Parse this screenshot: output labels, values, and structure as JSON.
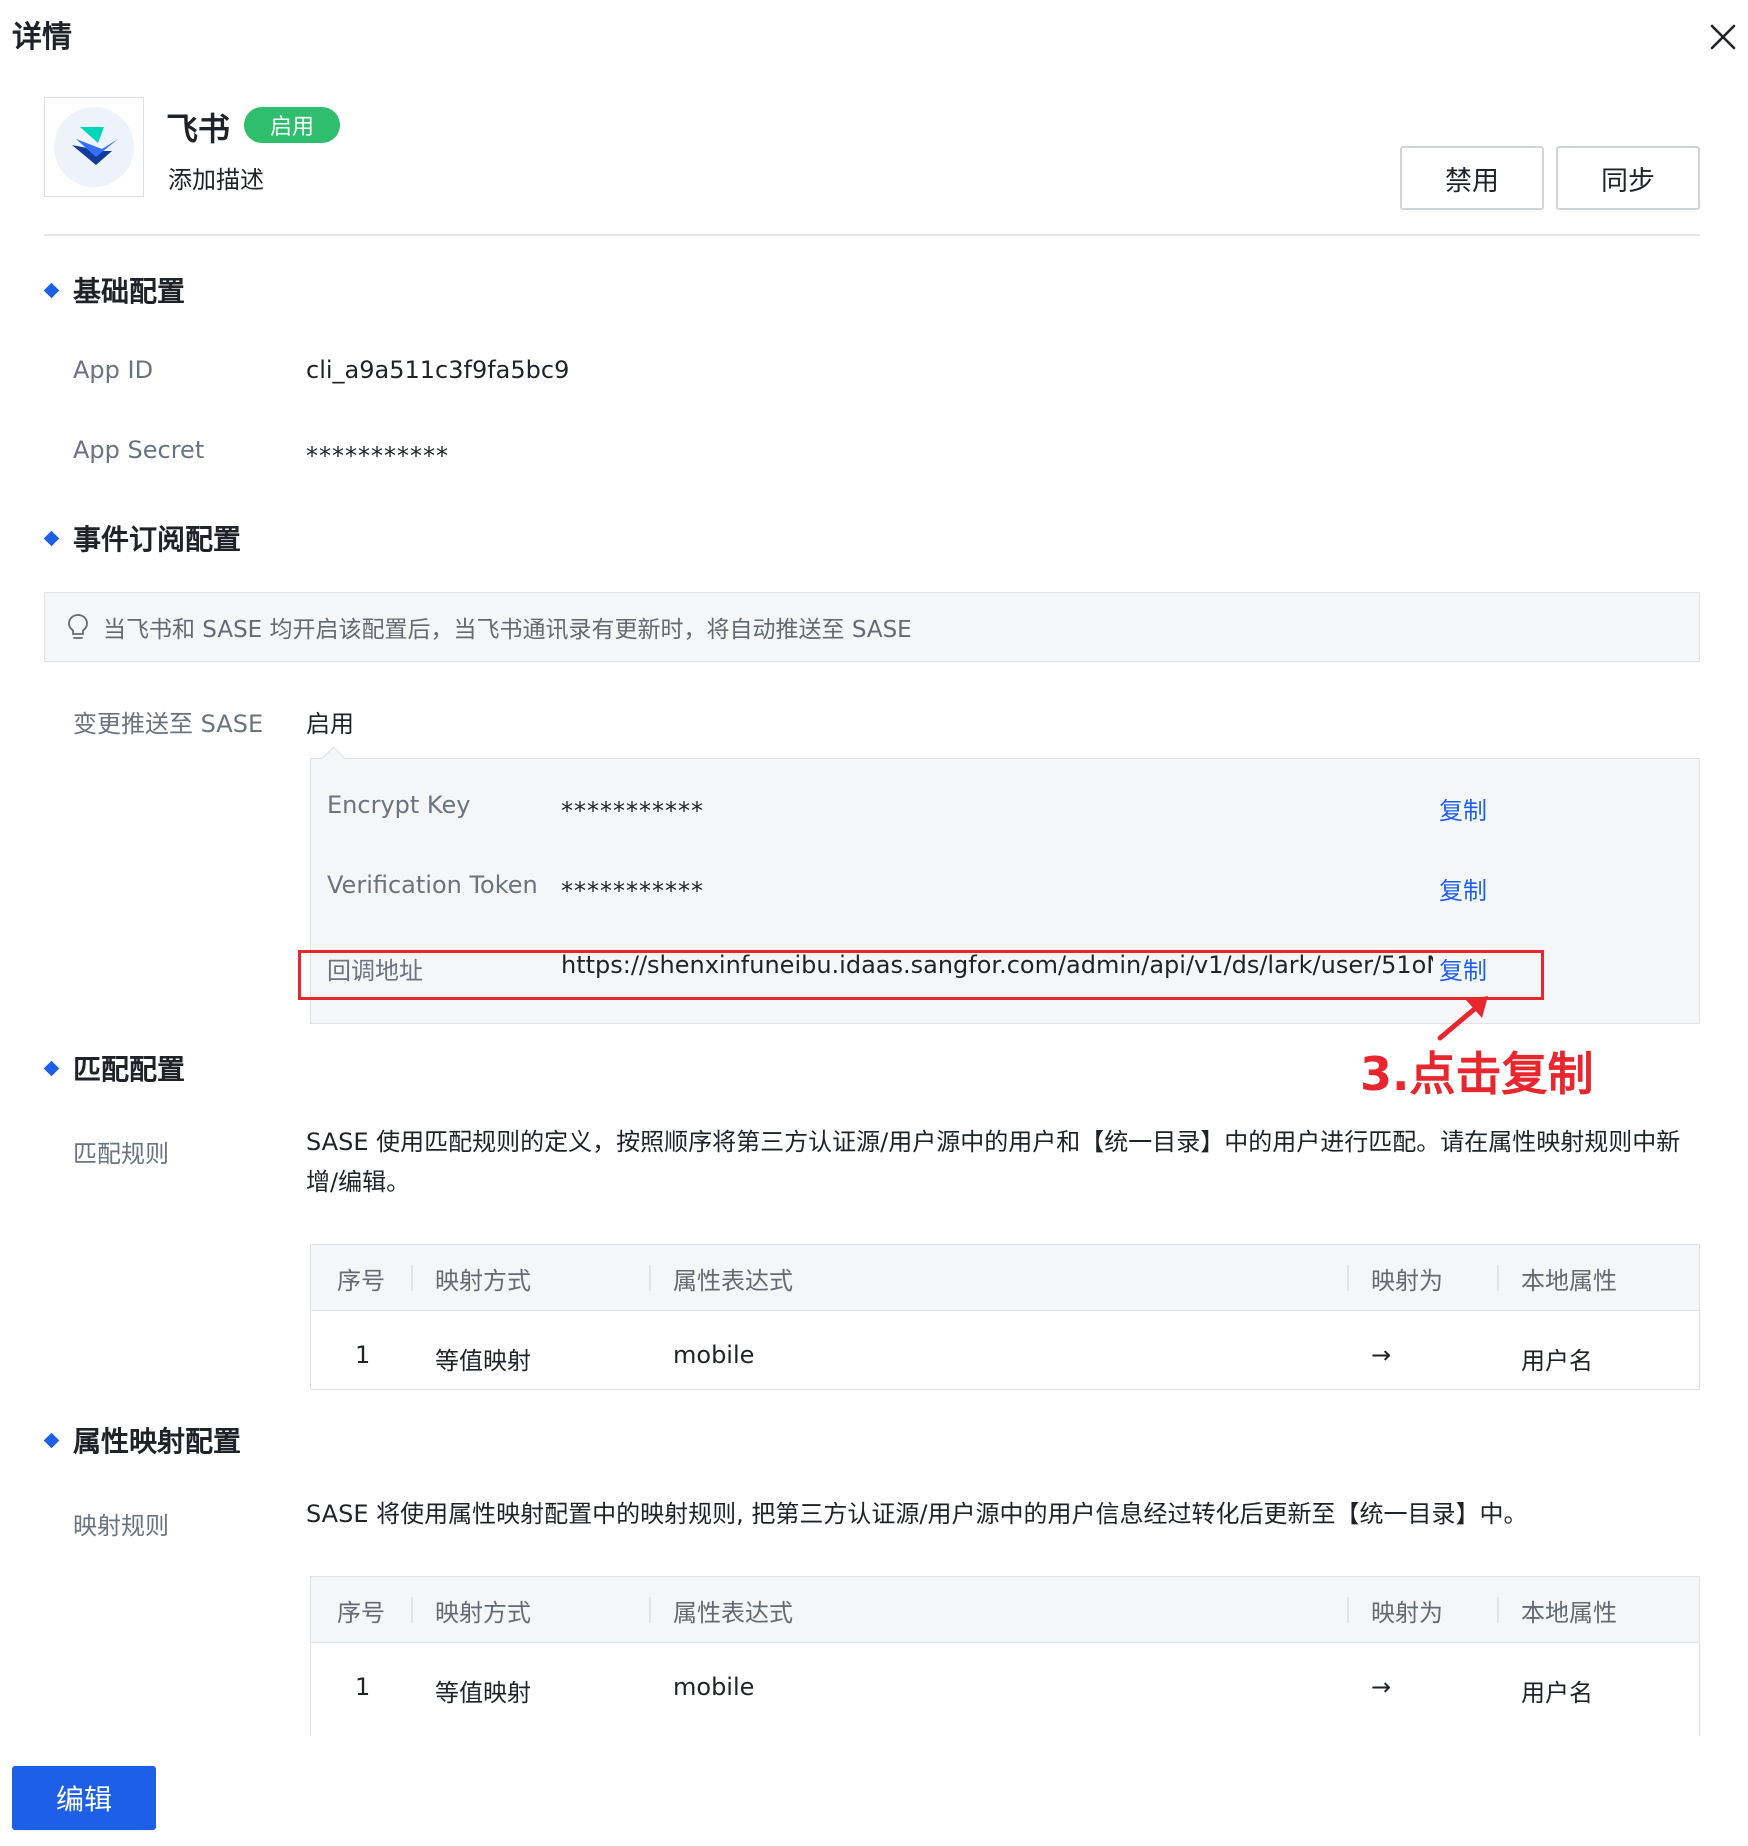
{
  "panel": {
    "title": "详情"
  },
  "app": {
    "name": "飞书",
    "status": "启用",
    "description": "添加描述",
    "disable_label": "禁用",
    "sync_label": "同步"
  },
  "basic": {
    "title": "基础配置",
    "app_id_label": "App ID",
    "app_id_value": "cli_a9a511c3f9fa5bc9",
    "app_secret_label": "App Secret",
    "app_secret_value": "***********"
  },
  "event": {
    "title": "事件订阅配置",
    "tip": "当飞书和 SASE 均开启该配置后，当飞书通讯录有更新时，将自动推送至 SASE",
    "push_label": "变更推送至 SASE",
    "push_value": "启用",
    "rows": [
      {
        "label": "Encrypt Key",
        "value": "***********",
        "action": "复制"
      },
      {
        "label": "Verification Token",
        "value": "***********",
        "action": "复制"
      },
      {
        "label": "回调地址",
        "value": "https://shenxinfuneibu.idaas.sangfor.com/admin/api/v1/ds/lark/user/51oN…",
        "action": "复制"
      }
    ],
    "annotation": "3.点击复制"
  },
  "match": {
    "title": "匹配配置",
    "rule_label": "匹配规则",
    "description": "SASE 使用匹配规则的定义，按照顺序将第三方认证源/用户源中的用户和【统一目录】中的用户进行匹配。请在属性映射规则中新增/编辑。",
    "table": {
      "headers": [
        "序号",
        "映射方式",
        "属性表达式",
        "映射为",
        "本地属性"
      ],
      "rows": [
        [
          "1",
          "等值映射",
          "mobile",
          "→",
          "用户名"
        ]
      ]
    }
  },
  "mapping": {
    "title": "属性映射配置",
    "rule_label": "映射规则",
    "description": "SASE 将使用属性映射配置中的映射规则, 把第三方认证源/用户源中的用户信息经过转化后更新至【统一目录】中。",
    "table": {
      "headers": [
        "序号",
        "映射方式",
        "属性表达式",
        "映射为",
        "本地属性"
      ],
      "rows": [
        [
          "1",
          "等值映射",
          "mobile",
          "→",
          "用户名"
        ]
      ]
    }
  },
  "footer": {
    "edit_label": "编辑"
  },
  "colors": {
    "primary": "#1d5fe6",
    "success": "#2fbd6e",
    "annotation": "#e8262e"
  }
}
